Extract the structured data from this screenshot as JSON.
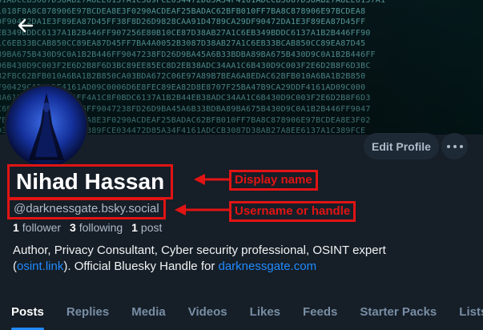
{
  "banner": {
    "hex_rows": [
      "81ADCCB3087D38AB27A8EE6137A1C389FCE034472D85A34F4161ADCCB3087D38AB27A8EE6137A1",
      "1018F8A8C878906E97BCDEA8E3F0290ACDEAF25BADAC62BFB010FF7BA8C878906E97BCDEA8",
      "DF90472DA1E3F89EA87D45FF38F8D26D9828CAA91D4789CA29DF90472DA1E3F89EA87D45FF",
      "EB349BDDC6137A1B2B446FF907256E80B10CE87D38AB27A1C6EB349BDDC6137A1B2B446FF90",
      "1C6EB33BCAB850CC89EA87D45FF7BA4A0052B3087D38AB27A1C6EB33BCAB850CC89EA87D45",
      "89BA675B430D9C0A1B2B446FF9047238FD26D9BA45A6B33BDBA89BA675B430D9C0A1B2B446FF",
      "D6B430D9C003F2E6D2B8F6D3BC89EE85EC8D2EB38ADC34AA1C6B430D9C003F2E6D2B8F6D3BC",
      "82FBC62BFB010A6BA1B2B850CA03BDA672C06E97A89B7BEA6A8EDAC62BFB010A6BA1B2B850",
      "F90429CA29DDF4161AD09C0006D6E8FEC89EA82D8E8707F25BA47B9CA29DDF4161AD09C000",
      "3A61B88CF90A7D45FF4A1C8F0BDC6137A1B2B44EB38ADC34AA1C6B430D9C003F2E6D2B8F6D3",
      "C6B430D9C0A1B2B446FF9047238FD26D9BA45A6B33BDBA89BA675B430D9C0A1B2B446FF9047",
      "7BA8C878906E97BCDEA8E3F0290ACDEAF25BADAC62BFB010FF7BA8C878906E97BCDEA8E3F02",
      "D38AB27A8EE6137A1C389FCE034472D85A34F4161ADCCB3087D38AB27A8EE6137A1C389FCE"
    ]
  },
  "profile": {
    "display_name": "Nihad Hassan",
    "handle": "@darknessgate.bsky.social",
    "edit_button_label": "Edit Profile",
    "stats": [
      {
        "count": "1",
        "label": "follower"
      },
      {
        "count": "3",
        "label": "following"
      },
      {
        "count": "1",
        "label": "post"
      }
    ],
    "bio": {
      "line1": "Author, Privacy Consultant, Cyber security professional, OSINT expert",
      "paren_open": "(",
      "link1": "osint.link",
      "middle": "). Official Bluesky Handle for ",
      "link2": "darknessgate.com"
    }
  },
  "annotations": {
    "display_name_label": "Display name",
    "handle_label": "Username or handle",
    "color": "#e11414"
  },
  "tabs": [
    {
      "label": "Posts",
      "active": true
    },
    {
      "label": "Replies",
      "active": false
    },
    {
      "label": "Media",
      "active": false
    },
    {
      "label": "Videos",
      "active": false
    },
    {
      "label": "Likes",
      "active": false
    },
    {
      "label": "Feeds",
      "active": false
    },
    {
      "label": "Starter Packs",
      "active": false
    },
    {
      "label": "Lists",
      "active": false
    }
  ],
  "colors": {
    "background": "#161e27",
    "accent": "#208bfe",
    "muted_text": "#788ea5"
  },
  "icons": {
    "back": "arrow-left-icon",
    "more": "ellipsis-icon"
  }
}
